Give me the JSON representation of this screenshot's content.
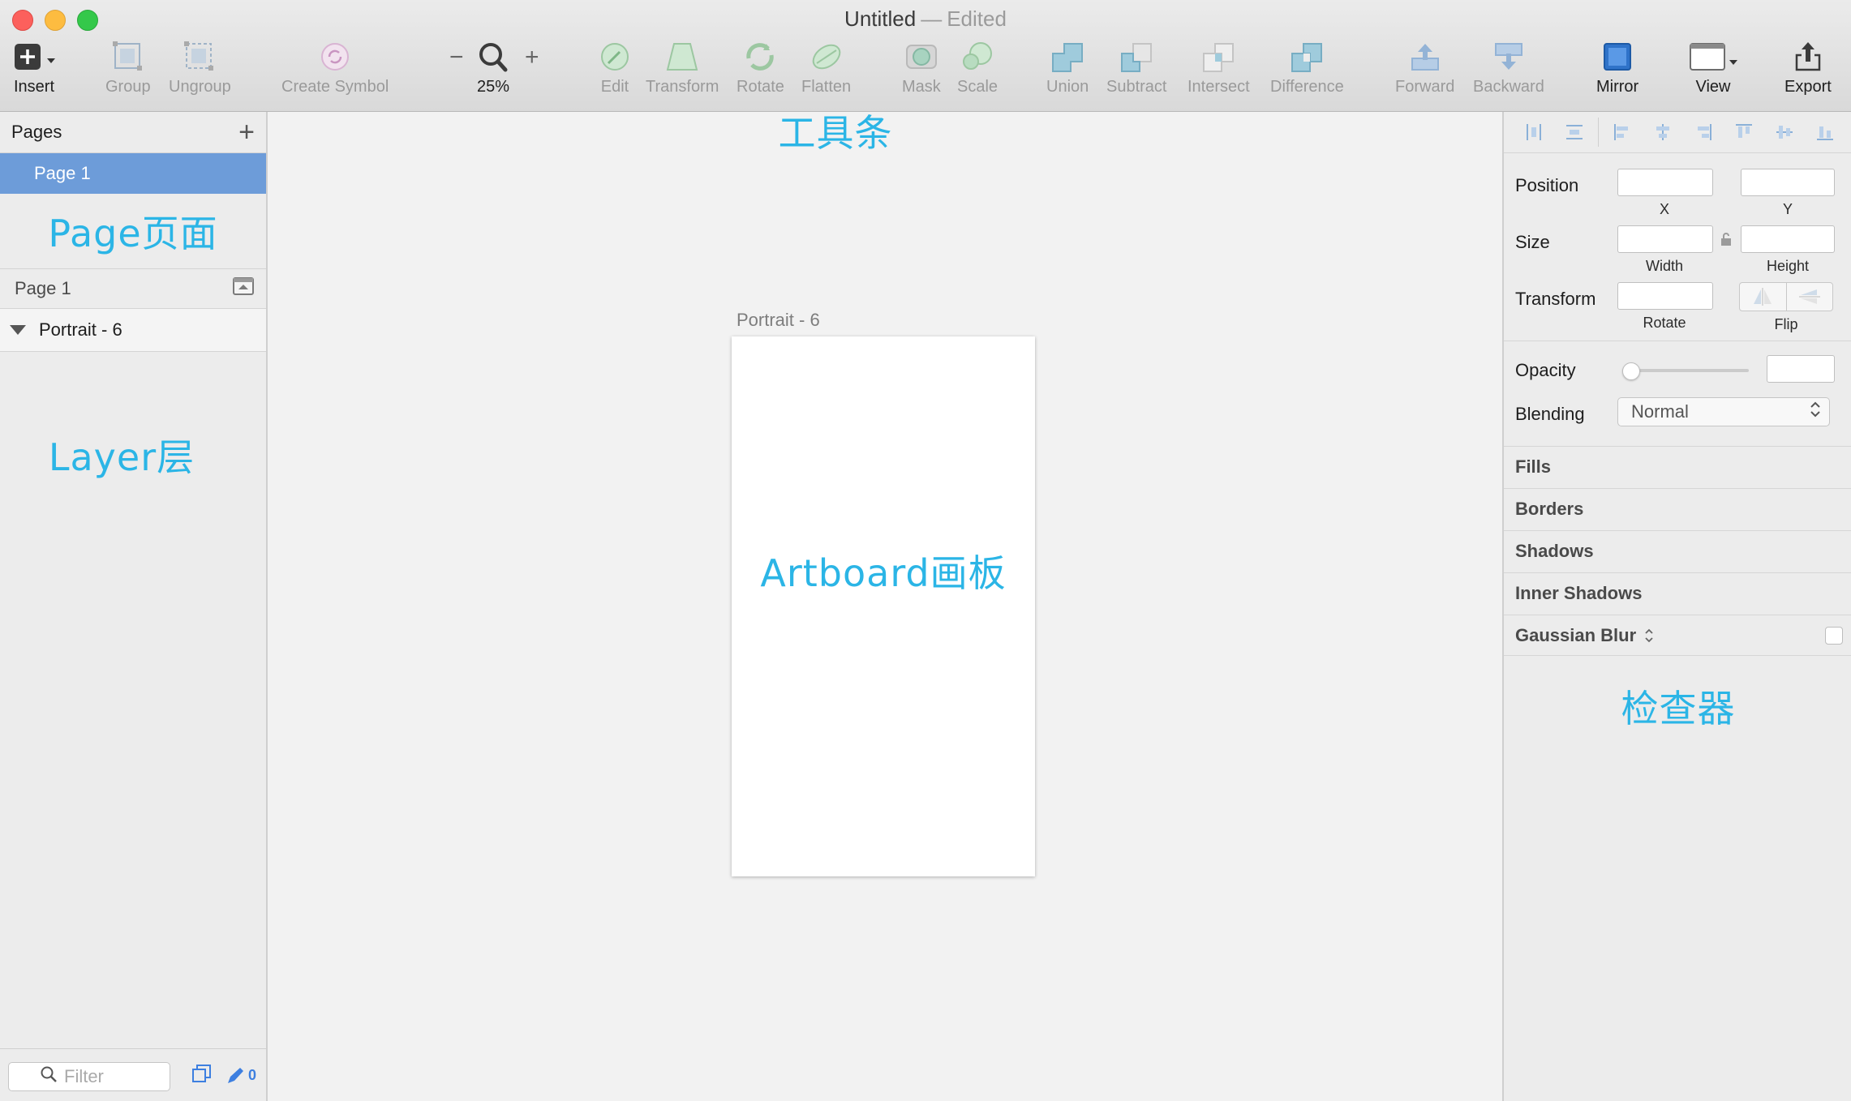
{
  "window": {
    "title": "Untitled",
    "separator": "—",
    "status": "Edited"
  },
  "toolbar": {
    "insert": "Insert",
    "group": "Group",
    "ungroup": "Ungroup",
    "create_symbol": "Create Symbol",
    "zoom_minus": "−",
    "zoom_plus": "+",
    "zoom_level": "25%",
    "edit": "Edit",
    "transform": "Transform",
    "rotate": "Rotate",
    "flatten": "Flatten",
    "mask": "Mask",
    "scale": "Scale",
    "union": "Union",
    "subtract": "Subtract",
    "intersect": "Intersect",
    "difference": "Difference",
    "forward": "Forward",
    "backward": "Backward",
    "mirror": "Mirror",
    "view": "View",
    "export": "Export"
  },
  "pages": {
    "header": "Pages",
    "add_icon": "+",
    "items": [
      {
        "label": "Page 1",
        "selected": true
      }
    ],
    "annotation": "Page页面"
  },
  "layers": {
    "page_label": "Page 1",
    "items": [
      {
        "label": "Portrait - 6",
        "expanded": true
      }
    ],
    "annotation": "Layer层"
  },
  "footer": {
    "filter_placeholder": "Filter",
    "edit_count": "0"
  },
  "canvas": {
    "toolbar_annotation": "工具条",
    "artboard_label": "Portrait - 6",
    "artboard_annotation": "Artboard画板"
  },
  "inspector": {
    "position_label": "Position",
    "x_label": "X",
    "y_label": "Y",
    "size_label": "Size",
    "width_label": "Width",
    "height_label": "Height",
    "transform_label": "Transform",
    "rotate_label": "Rotate",
    "flip_label": "Flip",
    "opacity_label": "Opacity",
    "opacity_value": 0,
    "blending_label": "Blending",
    "blending_value": "Normal",
    "sections": [
      "Fills",
      "Borders",
      "Shadows",
      "Inner Shadows",
      "Gaussian Blur"
    ],
    "annotation": "检查器"
  },
  "colors": {
    "annotation": "#2bb5e6",
    "selection": "#6d9cd9",
    "accent": "#3d7fe0"
  }
}
